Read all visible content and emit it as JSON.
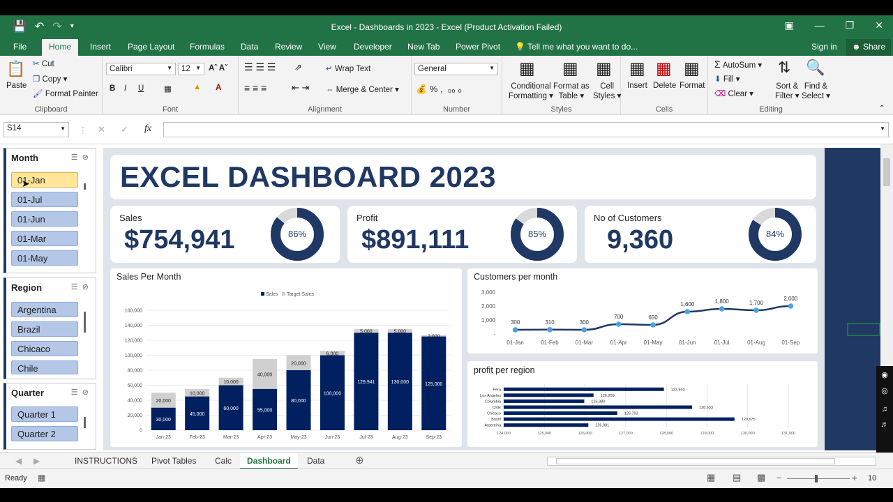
{
  "window": {
    "title": "Excel - Dashboards in 2023 - Excel (Product Activation Failed)"
  },
  "tabs": [
    "File",
    "Home",
    "Insert",
    "Page Layout",
    "Formulas",
    "Data",
    "Review",
    "View",
    "Developer",
    "New Tab",
    "Power Pivot"
  ],
  "tell_me": "Tell me what you want to do...",
  "sign_in": "Sign in",
  "share": "Share",
  "ribbon": {
    "clipboard": {
      "paste": "Paste",
      "cut": "Cut",
      "copy": "Copy",
      "format_painter": "Format Painter",
      "label": "Clipboard"
    },
    "font": {
      "name": "Calibri",
      "size": "12",
      "label": "Font"
    },
    "alignment": {
      "wrap": "Wrap Text",
      "merge": "Merge & Center",
      "label": "Alignment"
    },
    "number": {
      "format": "General",
      "label": "Number"
    },
    "styles": {
      "cond1": "Conditional",
      "cond2": "Formatting",
      "fmt1": "Format as",
      "fmt2": "Table",
      "cell1": "Cell",
      "cell2": "Styles",
      "label": "Styles"
    },
    "cells": {
      "insert": "Insert",
      "delete": "Delete",
      "format": "Format",
      "label": "Cells"
    },
    "editing": {
      "autosum": "AutoSum",
      "fill": "Fill",
      "clear": "Clear",
      "sort1": "Sort &",
      "sort2": "Filter",
      "find1": "Find &",
      "find2": "Select",
      "label": "Editing"
    }
  },
  "namebox": "S14",
  "fx": "fx",
  "slicers": {
    "month": {
      "title": "Month",
      "items": [
        "01-Jan",
        "01-Jul",
        "01-Jun",
        "01-Mar",
        "01-May"
      ]
    },
    "region": {
      "title": "Region",
      "items": [
        "Argentina",
        "Brazil",
        "Chicaco",
        "Chile"
      ]
    },
    "quarter": {
      "title": "Quarter",
      "items": [
        "Quarter 1",
        "Quarter 2"
      ]
    }
  },
  "dashboard": {
    "title": "EXCEL DASHBOARD 2023"
  },
  "kpis": [
    {
      "label": "Sales",
      "value": "$754,941",
      "pct": "86%",
      "fraction": 0.86
    },
    {
      "label": "Profit",
      "value": "$891,111",
      "pct": "85%",
      "fraction": 0.85
    },
    {
      "label": "No of Customers",
      "value": "9,360",
      "pct": "84%",
      "fraction": 0.84
    }
  ],
  "chart_data": [
    {
      "type": "bar",
      "title": "Sales Per Month",
      "categories": [
        "Jan-23",
        "Feb-23",
        "Mar-23",
        "Apr-23",
        "May-23",
        "Jun-23",
        "Jul-23",
        "Aug-23",
        "Sep-23"
      ],
      "series": [
        {
          "name": "Sales",
          "values": [
            30000,
            45000,
            60000,
            55000,
            80000,
            100000,
            129941,
            130000,
            125000
          ],
          "labels": [
            "30,000",
            "45,000",
            "60,000",
            "55,000",
            "80,000",
            "100,000",
            "129,941",
            "130,000",
            "125,000"
          ]
        },
        {
          "name": "Target Sales",
          "values": [
            20000,
            10000,
            10000,
            40000,
            20000,
            6000,
            5000,
            5000,
            2000
          ],
          "labels": [
            "20,000",
            "10,000",
            "10,000",
            "40,000",
            "20,000",
            "6,000",
            "5,000",
            "5,000",
            "2,000"
          ]
        }
      ],
      "yticks": [
        "0",
        "20,000",
        "40,000",
        "60,000",
        "80,000",
        "100,000",
        "120,000",
        "140,000",
        "160,000"
      ],
      "ylim": [
        0,
        160000
      ],
      "stacked": true,
      "legend": "top",
      "colors": [
        "#002060",
        "#d0d0d0"
      ]
    },
    {
      "type": "line",
      "title": "Customers per month",
      "categories": [
        "01-Jan",
        "01-Feb",
        "01-Mar",
        "01-Apr",
        "01-May",
        "01-Jun",
        "01-Jul",
        "01-Aug",
        "01-Sep"
      ],
      "values": [
        300,
        310,
        300,
        700,
        650,
        1600,
        1800,
        1700,
        2000
      ],
      "labels": [
        "300",
        "310",
        "300",
        "700",
        "650",
        "1,600",
        "1,800",
        "1,700",
        "2,000"
      ],
      "yticks": [
        "-",
        "1,000",
        "2,000",
        "3,000"
      ],
      "ylim": [
        0,
        3000
      ]
    },
    {
      "type": "bar",
      "orientation": "horizontal",
      "title": "profit per region",
      "categories": [
        "Peru",
        "Los Angeles",
        "Columbia",
        "Chile",
        "Chicaco",
        "Brazil",
        "Argentina"
      ],
      "values": [
        127940,
        126209,
        125980,
        128633,
        126793,
        129675,
        126081
      ],
      "labels": [
        "127,940",
        "126,209",
        "125,980",
        "128,633",
        "126,793",
        "129,675",
        "126,081"
      ],
      "xticks": [
        "124,000",
        "125,000",
        "126,000",
        "127,000",
        "128,000",
        "129,000",
        "130,000",
        "131,000"
      ],
      "xlim": [
        124000,
        131000
      ]
    }
  ],
  "sheets": [
    "INSTRUCTIONS",
    "Pivot Tables",
    "Calc",
    "Dashboard",
    "Data"
  ],
  "status": {
    "ready": "Ready",
    "zoom": "10"
  }
}
